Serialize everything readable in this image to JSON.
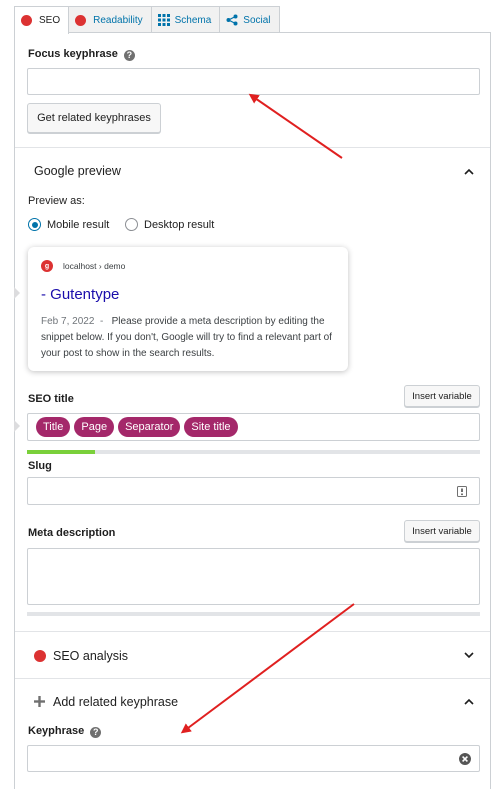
{
  "tabs": [
    {
      "label": "SEO",
      "icon": "red-dot-icon"
    },
    {
      "label": "Readability",
      "icon": "red-dot-icon"
    },
    {
      "label": "Schema",
      "icon": "grid-icon"
    },
    {
      "label": "Social",
      "icon": "share-icon"
    }
  ],
  "focus": {
    "label": "Focus keyphrase",
    "value": "",
    "related_button": "Get related keyphrases"
  },
  "google_preview": {
    "title": "Google preview",
    "preview_as_label": "Preview as:",
    "options": [
      "Mobile result",
      "Desktop result"
    ],
    "selected": "Mobile result",
    "card": {
      "favicon": "g",
      "url": "localhost › demo",
      "title": "- Gutentype",
      "date": "Feb 7, 2022",
      "separator": "-",
      "description": "Please provide a meta description by editing the snippet below. If you don't, Google will try to find a relevant part of your post to show in the search results."
    }
  },
  "seo_title": {
    "label": "SEO title",
    "insert_variable": "Insert variable",
    "pills": [
      "Title",
      "Page",
      "Separator",
      "Site title"
    ],
    "progress": 0.15
  },
  "slug": {
    "label": "Slug",
    "value": ""
  },
  "meta_description": {
    "label": "Meta description",
    "insert_variable": "Insert variable",
    "value": ""
  },
  "seo_analysis": {
    "title": "SEO analysis"
  },
  "related": {
    "title": "Add related keyphrase",
    "keyphrase_label": "Keyphrase",
    "value": ""
  },
  "colors": {
    "accent": "#0073aa",
    "pill": "#a4286a",
    "bad": "#dc3232",
    "good": "#7ad03a",
    "annotation": "#e02020"
  }
}
